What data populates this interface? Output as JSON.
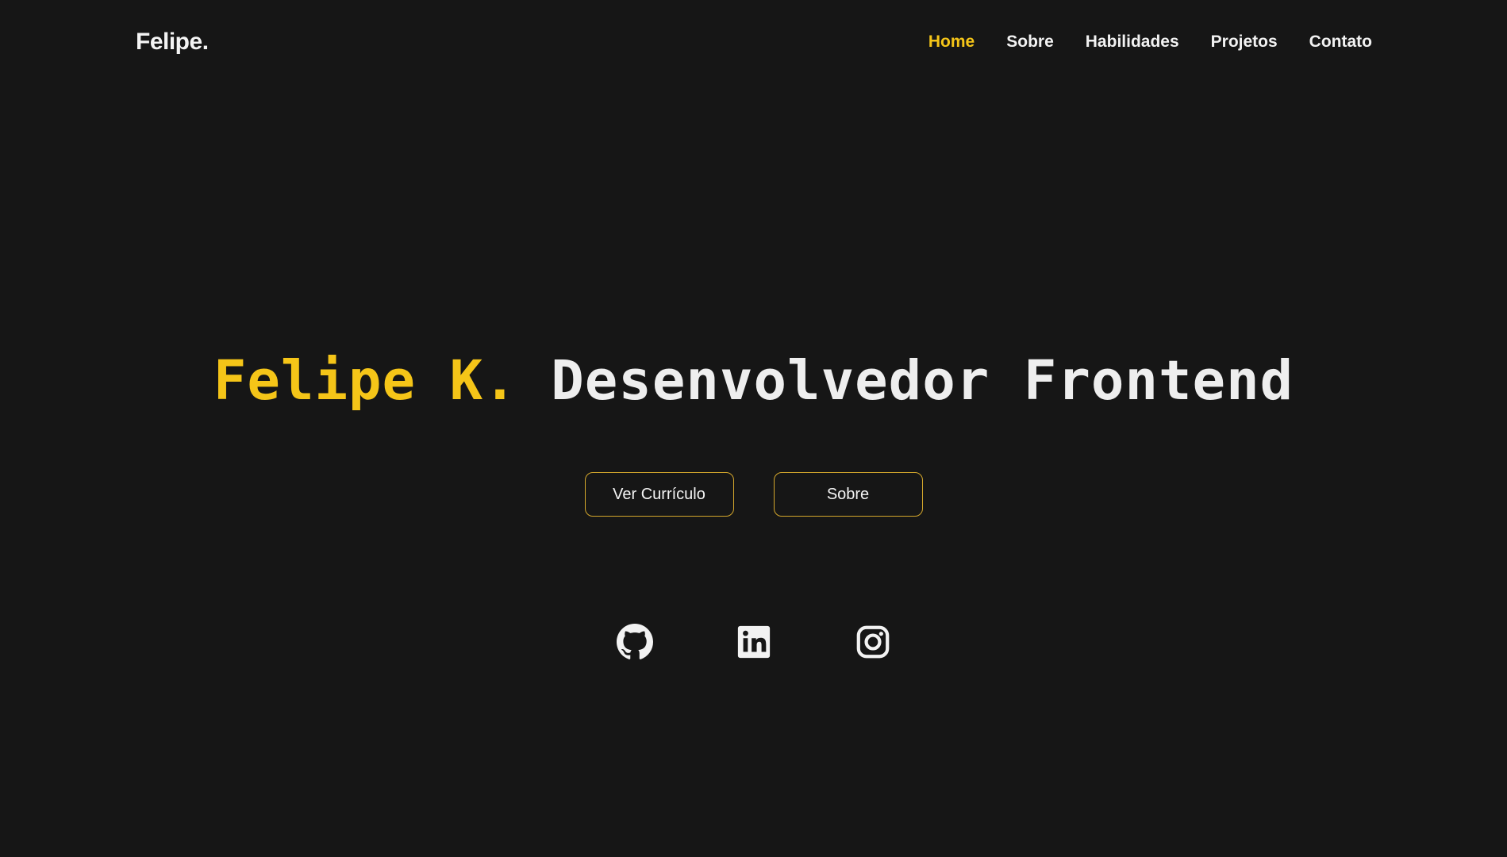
{
  "header": {
    "logo": "Felipe.",
    "nav": [
      {
        "label": "Home",
        "active": true
      },
      {
        "label": "Sobre",
        "active": false
      },
      {
        "label": "Habilidades",
        "active": false
      },
      {
        "label": "Projetos",
        "active": false
      },
      {
        "label": "Contato",
        "active": false
      }
    ]
  },
  "hero": {
    "name": "Felipe K.",
    "role": "Desenvolvedor Frontend",
    "buttons": {
      "resume": "Ver Currículo",
      "about": "Sobre"
    }
  },
  "socials": [
    {
      "icon": "github-icon"
    },
    {
      "icon": "linkedin-icon"
    },
    {
      "icon": "instagram-icon"
    }
  ],
  "colors": {
    "background": "#161616",
    "accent": "#f5c518",
    "text": "#f2f2f2",
    "button_border": "#d4a72c"
  }
}
